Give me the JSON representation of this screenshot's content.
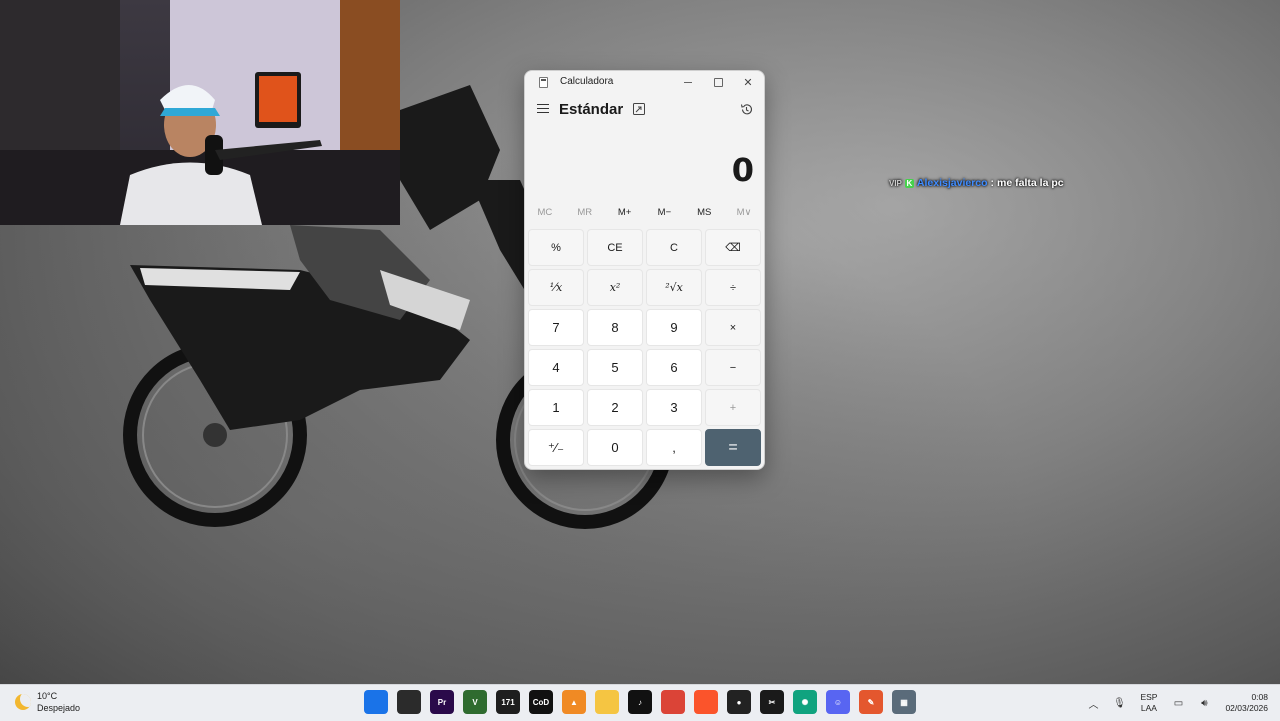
{
  "chat": {
    "mod_tag": "VIP",
    "badge": "K",
    "username": "Alexisjavierco",
    "separator": ":",
    "message": "me falta la pc"
  },
  "calculator": {
    "window_title": "Calculadora",
    "mode": "Estándar",
    "display_value": "0",
    "memory_buttons": [
      {
        "label": "MC",
        "enabled": false
      },
      {
        "label": "MR",
        "enabled": false
      },
      {
        "label": "M+",
        "enabled": true
      },
      {
        "label": "M−",
        "enabled": true
      },
      {
        "label": "MS",
        "enabled": true
      },
      {
        "label": "M∨",
        "enabled": false
      }
    ],
    "keys": {
      "percent": "%",
      "ce": "CE",
      "c": "C",
      "backspace": "⌫",
      "reciprocal": "⅟x",
      "square": "x²",
      "sqrt": "²√x",
      "divide": "÷",
      "seven": "7",
      "eight": "8",
      "nine": "9",
      "multiply": "×",
      "four": "4",
      "five": "5",
      "six": "6",
      "minus": "−",
      "one": "1",
      "two": "2",
      "three": "3",
      "plus": "+",
      "negate": "⁺∕₋",
      "zero": "0",
      "decimal": ",",
      "equals": "="
    }
  },
  "taskbar": {
    "weather_temp": "10°C",
    "weather_desc": "Despejado",
    "apps": [
      {
        "name": "start",
        "label": "",
        "color": "#1a73e8"
      },
      {
        "name": "task-view",
        "label": "",
        "color": "#2b2b2b"
      },
      {
        "name": "premiere",
        "label": "Pr",
        "color": "#2a0a4a"
      },
      {
        "name": "gta-v",
        "label": "V",
        "color": "#2f6b2f"
      },
      {
        "name": "171",
        "label": "171",
        "color": "#1e1e1e"
      },
      {
        "name": "call-of-duty",
        "label": "CoD",
        "color": "#111111"
      },
      {
        "name": "vlc",
        "label": "▲",
        "color": "#f08a24"
      },
      {
        "name": "file-explorer",
        "label": "",
        "color": "#f5c542"
      },
      {
        "name": "tiktok",
        "label": "♪",
        "color": "#111111"
      },
      {
        "name": "chrome",
        "label": "",
        "color": "#db4437"
      },
      {
        "name": "brave",
        "label": "",
        "color": "#fb542b"
      },
      {
        "name": "obs",
        "label": "●",
        "color": "#222222"
      },
      {
        "name": "capcut",
        "label": "✂",
        "color": "#1a1a1a"
      },
      {
        "name": "chatgpt",
        "label": "✺",
        "color": "#10a37f"
      },
      {
        "name": "discord",
        "label": "☺",
        "color": "#5865f2"
      },
      {
        "name": "snipping",
        "label": "✎",
        "color": "#e4572e"
      },
      {
        "name": "calculator",
        "label": "▦",
        "color": "#5a6b7a"
      }
    ],
    "lang_top": "ESP",
    "lang_bottom": "LAA",
    "time": "0:08",
    "date": "02/03/2026"
  }
}
